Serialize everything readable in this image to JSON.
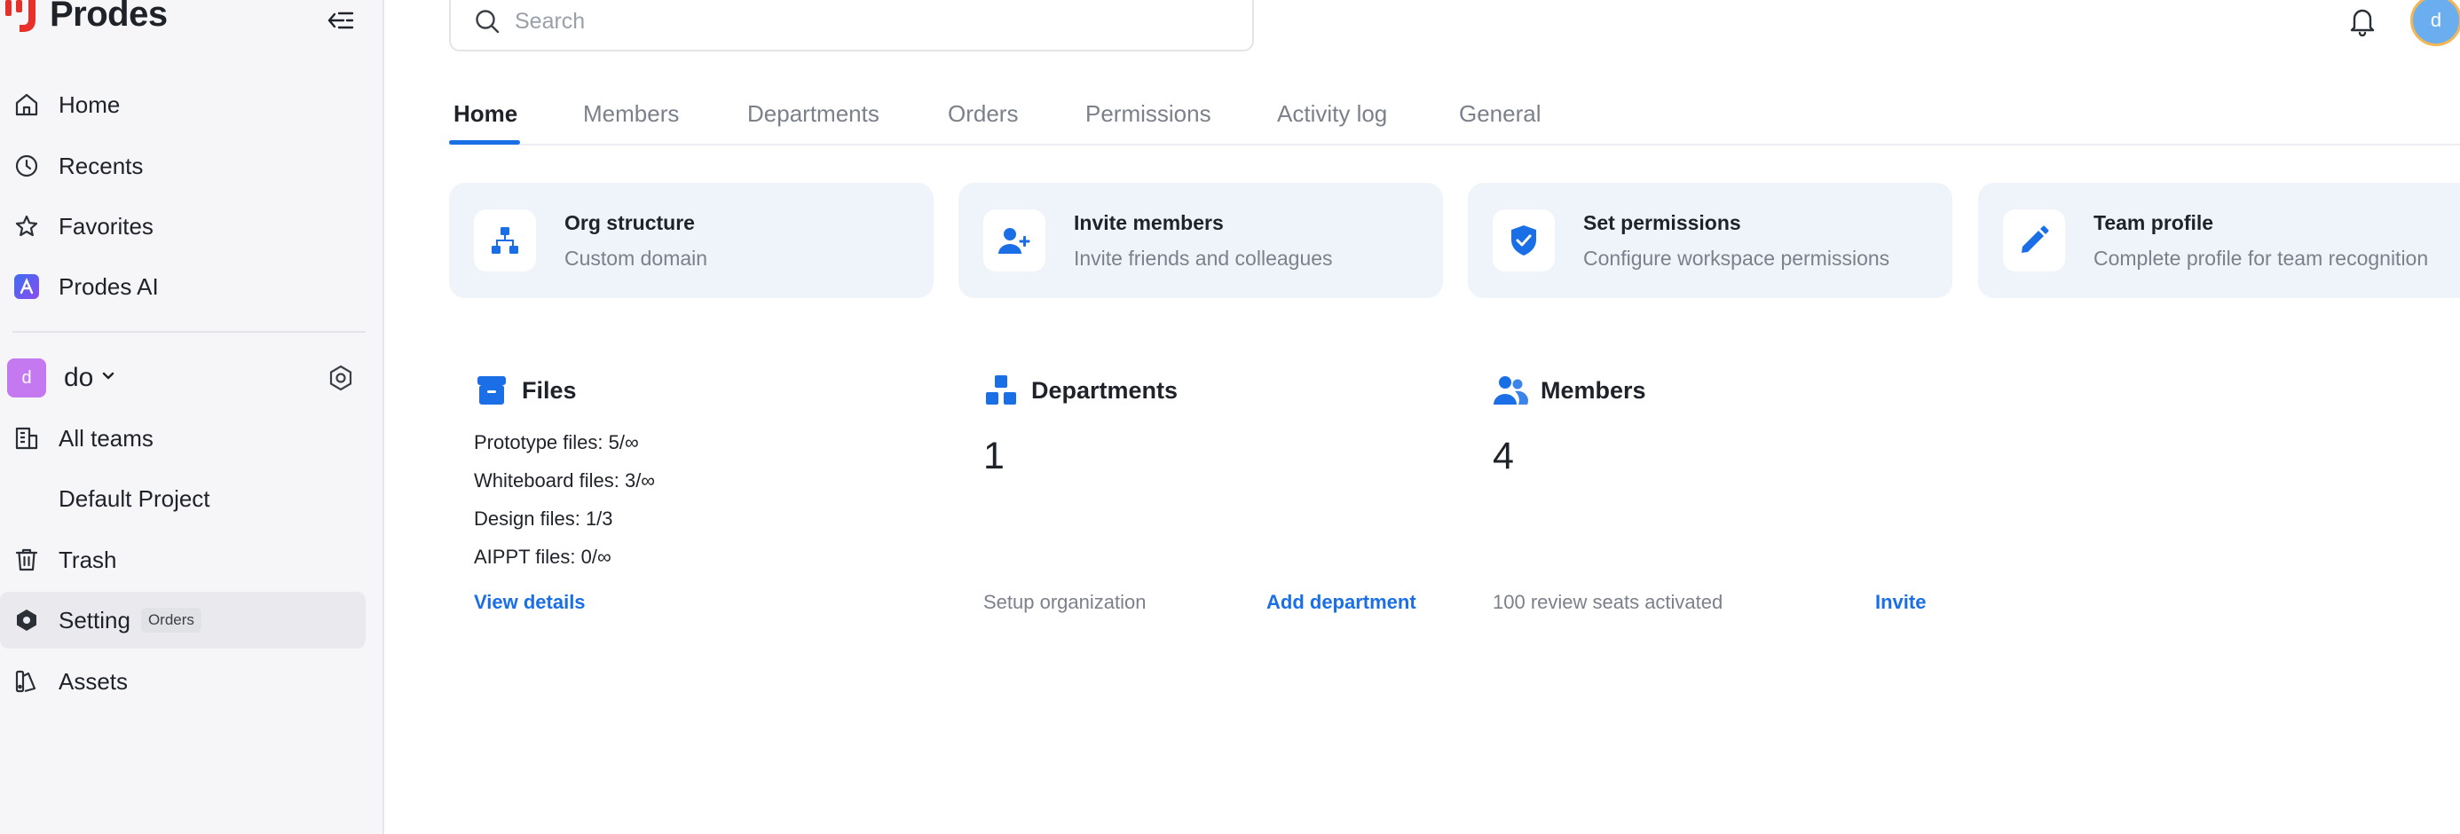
{
  "app": {
    "name": "Prodes"
  },
  "sidebar": {
    "nav": [
      {
        "label": "Home"
      },
      {
        "label": "Recents"
      },
      {
        "label": "Favorites"
      },
      {
        "label": "Prodes AI"
      }
    ],
    "team": {
      "avatar": "d",
      "name": "do"
    },
    "team_nav": [
      {
        "label": "All teams"
      },
      {
        "label": "Default Project"
      },
      {
        "label": "Trash"
      },
      {
        "label": "Setting",
        "badge": "Orders"
      },
      {
        "label": "Assets"
      }
    ]
  },
  "search": {
    "placeholder": "Search"
  },
  "user": {
    "avatar": "d"
  },
  "tabs": [
    {
      "label": "Home",
      "active": true
    },
    {
      "label": "Members"
    },
    {
      "label": "Departments"
    },
    {
      "label": "Orders"
    },
    {
      "label": "Permissions"
    },
    {
      "label": "Activity log"
    },
    {
      "label": "General"
    }
  ],
  "quick_cards": [
    {
      "title": "Org structure",
      "subtitle": "Custom domain",
      "icon": "org-structure-icon"
    },
    {
      "title": "Invite members",
      "subtitle": "Invite friends and colleagues",
      "icon": "add-user-icon"
    },
    {
      "title": "Set permissions",
      "subtitle": "Configure workspace permissions",
      "icon": "shield-check-icon"
    },
    {
      "title": "Team profile",
      "subtitle": "Complete profile for team recognition",
      "icon": "pencil-icon"
    }
  ],
  "files": {
    "title": "Files",
    "lines": [
      "Prototype files: 5/∞",
      "Whiteboard files: 3/∞",
      "Design files: 1/3",
      "AIPPT files: 0/∞"
    ],
    "link": "View details"
  },
  "departments": {
    "title": "Departments",
    "count": "1",
    "note": "Setup organization",
    "link": "Add department"
  },
  "members": {
    "title": "Members",
    "count": "4",
    "note": "100 review seats activated",
    "link": "Invite"
  },
  "colors": {
    "accent": "#1a6ee6",
    "card_bg": "#eff4fb",
    "sidebar_bg": "#f6f6f8",
    "logo_red": "#e8302a"
  }
}
